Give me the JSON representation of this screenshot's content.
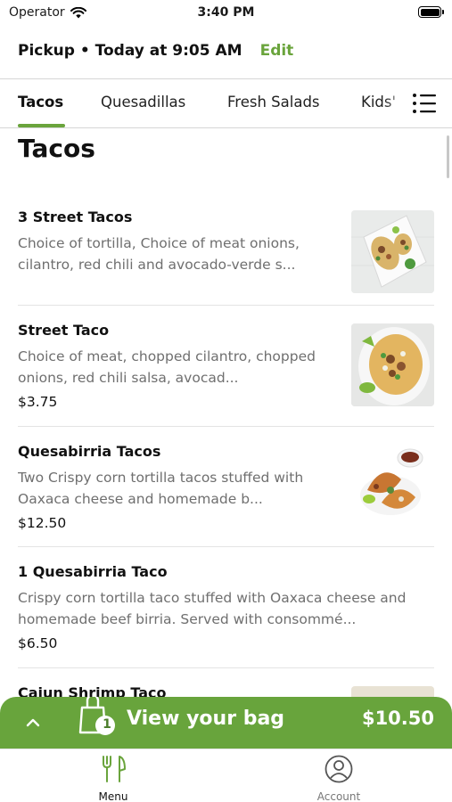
{
  "status_bar": {
    "carrier": "Operator",
    "time": "3:40 PM"
  },
  "header": {
    "pickup_text": "Pickup • Today at 9:05 AM",
    "edit_label": "Edit"
  },
  "tabs": [
    {
      "label": "Tacos",
      "active": true
    },
    {
      "label": "Quesadillas",
      "active": false
    },
    {
      "label": "Fresh Salads",
      "active": false
    },
    {
      "label": "Kids'",
      "active": false
    }
  ],
  "section": {
    "title": "Tacos"
  },
  "items": [
    {
      "name": "3 Street Tacos",
      "description": "Choice of tortilla, Choice of meat onions, cilantro, red chili and avocado-verde s...",
      "price": ""
    },
    {
      "name": "Street Taco",
      "description": "Choice of meat, chopped cilantro, chopped onions, red chili salsa, avocad...",
      "price": "$3.75"
    },
    {
      "name": "Quesabirria Tacos",
      "description": "Two Crispy corn tortilla tacos stuffed with Oaxaca cheese and homemade b...",
      "price": "$12.50"
    },
    {
      "name": "1 Quesabirria Taco",
      "description": "Crispy corn tortilla taco stuffed with Oaxaca cheese and homemade beef birria. Served with consommé...",
      "price": "$6.50"
    },
    {
      "name": "Cajun Shrimp Taco",
      "description": "",
      "price": ""
    }
  ],
  "bag": {
    "label": "View your bag",
    "count": "1",
    "total": "$10.50"
  },
  "nav": {
    "menu_label": "Menu",
    "account_label": "Account"
  },
  "colors": {
    "accent": "#6aa43c",
    "bag_bar": "#68a43c"
  },
  "icons": [
    "wifi-icon",
    "battery-icon",
    "hamburger-menu-icon",
    "chevron-up-icon",
    "shopping-bag-icon",
    "fork-knife-icon",
    "account-icon"
  ]
}
